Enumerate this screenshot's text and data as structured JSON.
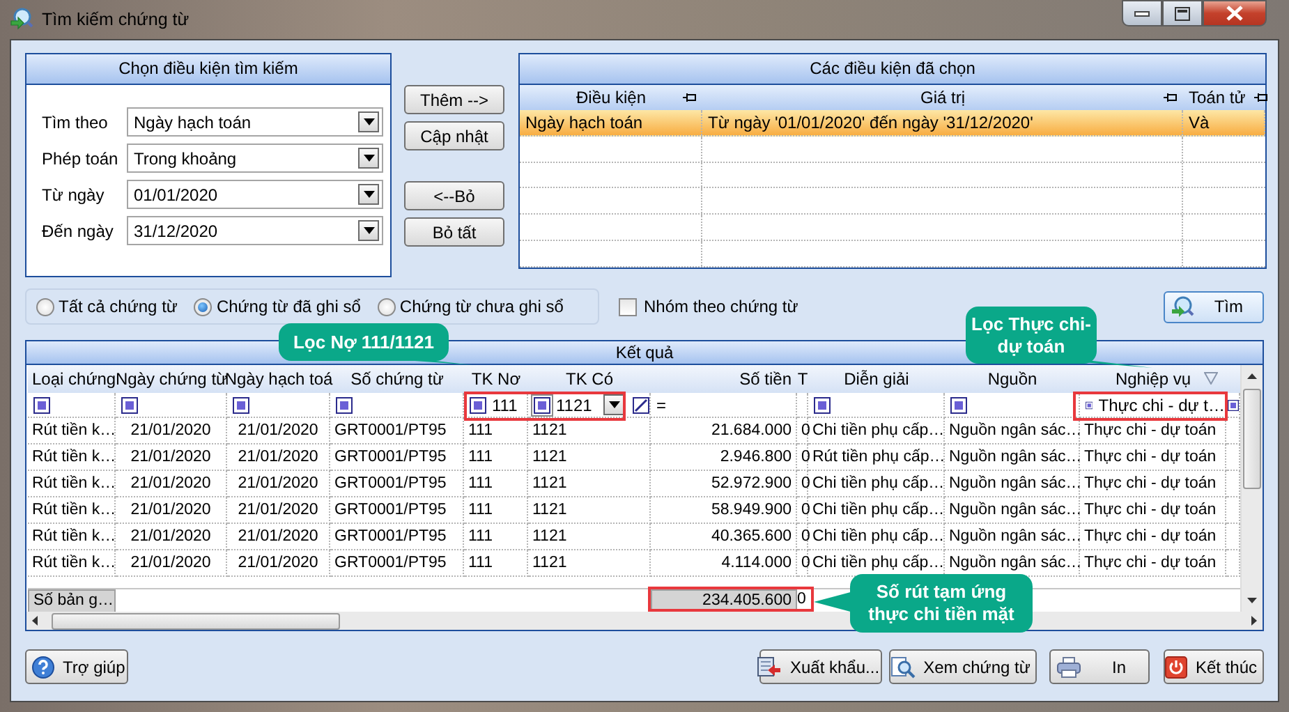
{
  "window": {
    "title": "Tìm kiếm chứng từ"
  },
  "search_conditions": {
    "title": "Chọn điều kiện tìm kiếm",
    "fields": [
      {
        "label": "Tìm theo",
        "value": "Ngày hạch toán"
      },
      {
        "label": "Phép toán",
        "value": "Trong khoảng"
      },
      {
        "label": "Từ ngày",
        "value": "01/01/2020"
      },
      {
        "label": "Đến ngày",
        "value": "31/12/2020"
      }
    ]
  },
  "condition_buttons": [
    "Thêm -->",
    "Cập nhật",
    "<--Bỏ",
    "Bỏ tất"
  ],
  "selected_conditions": {
    "title": "Các điều kiện đã chọn",
    "columns": [
      "Điều kiện",
      "Giá trị",
      "Toán tử"
    ],
    "rows": [
      {
        "cells": [
          "Ngày hạch toán",
          "Từ ngày '01/01/2020' đến ngày '31/12/2020'",
          "Và"
        ],
        "selected": true
      }
    ]
  },
  "voucher_filter": [
    {
      "label": "Tất cả chứng từ",
      "selected": false
    },
    {
      "label": "Chứng từ đã ghi sổ",
      "selected": true
    },
    {
      "label": "Chứng từ chưa ghi sổ",
      "selected": false
    }
  ],
  "group_by_voucher": {
    "label": "Nhóm theo chứng từ",
    "checked": false
  },
  "search_button": "Tìm",
  "results": {
    "title": "Kết quả",
    "columns": [
      {
        "label": "Loại chứng",
        "kind": "text",
        "filter": {
          "kind": "checkbox"
        }
      },
      {
        "label": "Ngày chứng từ",
        "kind": "date",
        "filter": {
          "kind": "checkbox"
        }
      },
      {
        "label": "Ngày hạch toá",
        "kind": "date",
        "filter": {
          "kind": "checkbox"
        }
      },
      {
        "label": "Số chứng từ",
        "kind": "text",
        "filter": {
          "kind": "checkbox"
        }
      },
      {
        "label": "TK Nơ",
        "kind": "text",
        "filter": {
          "kind": "checkbox",
          "value": "111"
        }
      },
      {
        "label": "TK Có",
        "kind": "text",
        "filter": {
          "kind": "dropdown",
          "value": "1121"
        }
      },
      {
        "label": "Số tiền",
        "kind": "money",
        "filter": {
          "kind": "operator",
          "value": "="
        }
      },
      {
        "label": "T",
        "kind": "text",
        "filter": {
          "kind": "none"
        }
      },
      {
        "label": "Diễn giải",
        "kind": "text",
        "filter": {
          "kind": "checkbox"
        }
      },
      {
        "label": "Nguồn",
        "kind": "text",
        "filter": {
          "kind": "checkbox"
        }
      },
      {
        "label": "Nghiệp vụ",
        "kind": "text",
        "filter_active": true,
        "filter": {
          "kind": "checkbox",
          "value": "Thực chi - dự t…"
        }
      }
    ],
    "rows": [
      [
        "Rút tiền k…",
        "21/01/2020",
        "21/01/2020",
        "GRT0001/PT95",
        "111",
        "1121",
        "21.684.000",
        "0",
        "Chi tiền phụ cấp…",
        "Nguồn ngân sác…",
        "Thực chi - dự toán"
      ],
      [
        "Rút tiền k…",
        "21/01/2020",
        "21/01/2020",
        "GRT0001/PT95",
        "111",
        "1121",
        "2.946.800",
        "0",
        "Rút tiền phụ cấp…",
        "Nguồn ngân sác…",
        "Thực chi - dự toán"
      ],
      [
        "Rút tiền k…",
        "21/01/2020",
        "21/01/2020",
        "GRT0001/PT95",
        "111",
        "1121",
        "52.972.900",
        "0",
        "Chi tiền phụ cấp…",
        "Nguồn ngân sác…",
        "Thực chi - dự toán"
      ],
      [
        "Rút tiền k…",
        "21/01/2020",
        "21/01/2020",
        "GRT0001/PT95",
        "111",
        "1121",
        "58.949.900",
        "0",
        "Chi tiền phụ cấp…",
        "Nguồn ngân sác…",
        "Thực chi - dự toán"
      ],
      [
        "Rút tiền k…",
        "21/01/2020",
        "21/01/2020",
        "GRT0001/PT95",
        "111",
        "1121",
        "40.365.600",
        "0",
        "Chi tiền phụ cấp…",
        "Nguồn ngân sác…",
        "Thực chi - dự toán"
      ],
      [
        "Rút tiền k…",
        "21/01/2020",
        "21/01/2020",
        "GRT0001/PT95",
        "111",
        "1121",
        "4.114.000",
        "0",
        "Chi tiền phụ cấp…",
        "Nguồn ngân sác…",
        "Thực chi - dự toán"
      ]
    ],
    "footer": {
      "label": "Số bản g…",
      "total": "234.405.600",
      "total_t": "0"
    }
  },
  "callouts": [
    {
      "text": "Lọc Nợ 111/1121"
    },
    {
      "text": "Lọc Thực chi- dự toán"
    },
    {
      "text": "Số rút tạm ứng thực chi tiền mặt"
    }
  ],
  "bottom_buttons": [
    {
      "label": "Trợ giúp",
      "kind": "help"
    },
    {
      "label": "Xuất khẩu...",
      "kind": "export"
    },
    {
      "label": "Xem chứng từ",
      "kind": "view"
    },
    {
      "label": "In",
      "kind": "print"
    },
    {
      "label": "Kết thúc",
      "kind": "exit"
    }
  ]
}
